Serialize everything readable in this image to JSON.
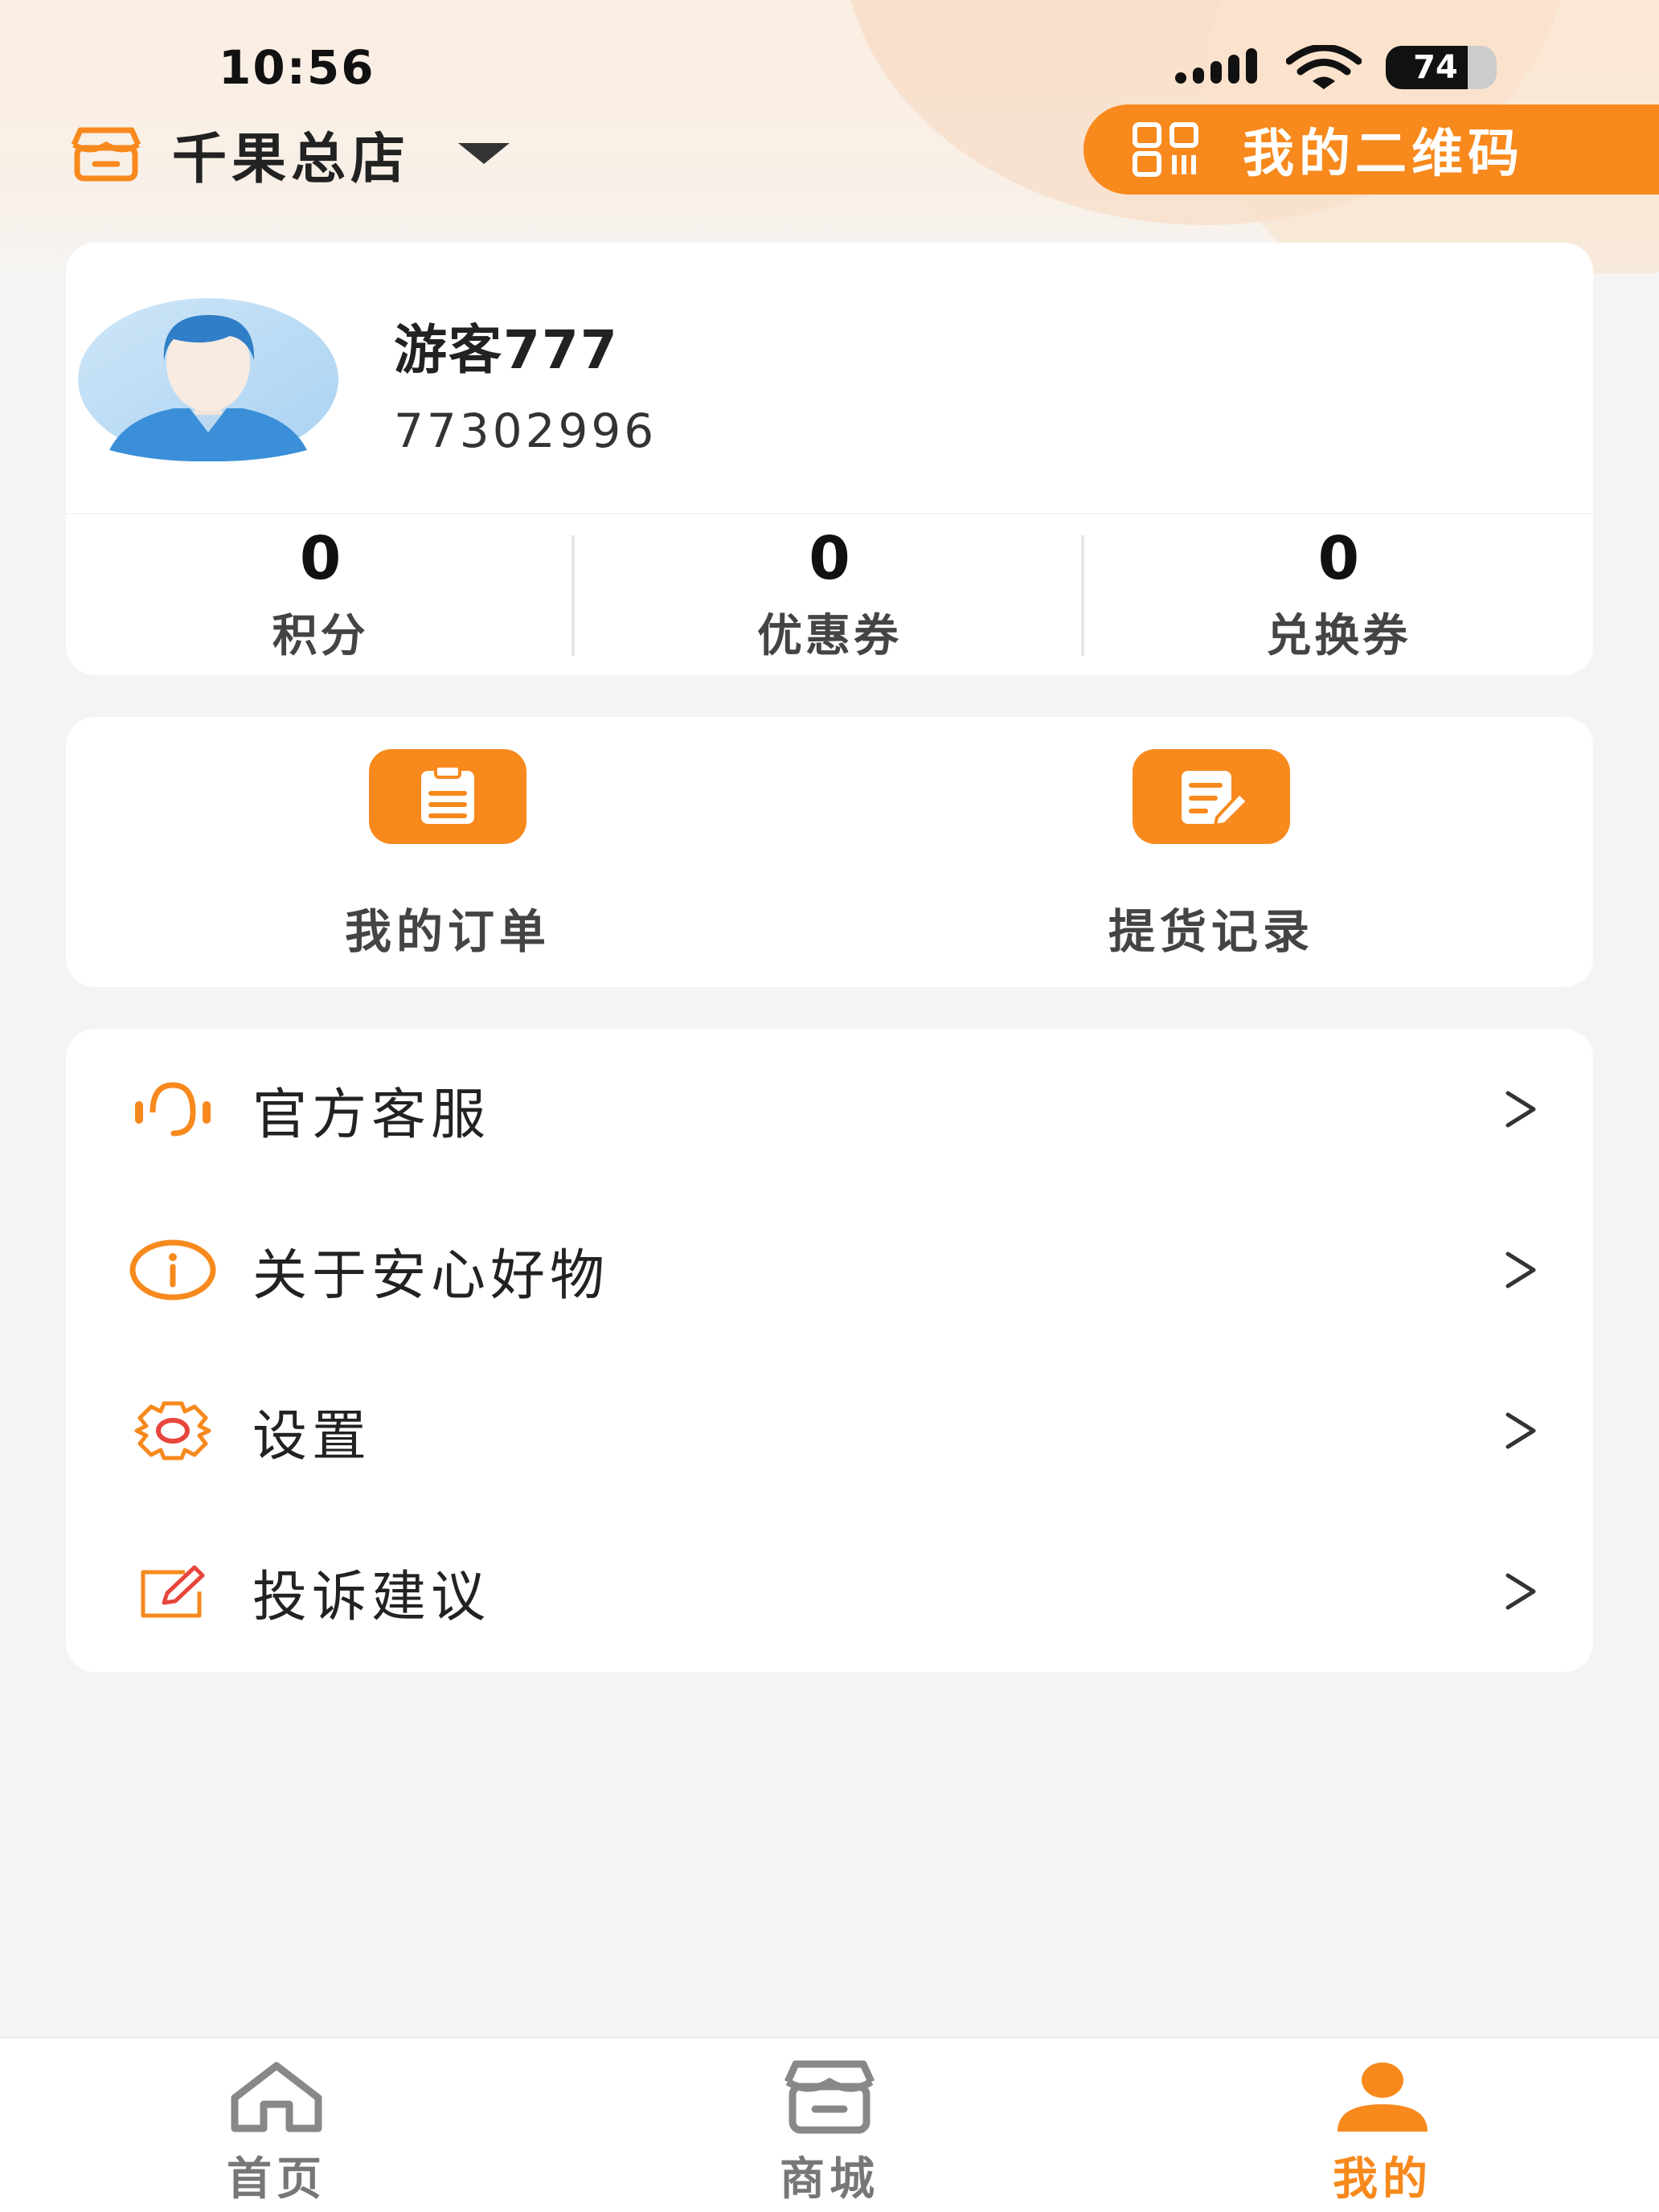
{
  "status_bar": {
    "time": "10:56",
    "battery": "74",
    "battery_level": 0.74
  },
  "header": {
    "store_name": "千果总店",
    "qr_button_label": "我的二维码"
  },
  "profile": {
    "name": "游客777",
    "id": "77302996"
  },
  "stats": [
    {
      "value": "0",
      "label": "积分"
    },
    {
      "value": "0",
      "label": "优惠券"
    },
    {
      "value": "0",
      "label": "兑换券"
    }
  ],
  "actions": [
    {
      "label": "我的订单",
      "icon": "clipboard-icon"
    },
    {
      "label": "提货记录",
      "icon": "edit-document-icon"
    }
  ],
  "menu": [
    {
      "label": "官方客服",
      "icon": "headset-icon"
    },
    {
      "label": "关于安心好物",
      "icon": "info-icon"
    },
    {
      "label": "设置",
      "icon": "gear-icon"
    },
    {
      "label": "投诉建议",
      "icon": "edit-icon"
    }
  ],
  "bottom_nav": [
    {
      "label": "首页",
      "icon": "home-icon",
      "active": false
    },
    {
      "label": "商城",
      "icon": "shop-icon",
      "active": false
    },
    {
      "label": "我的",
      "icon": "person-icon",
      "active": true
    }
  ],
  "colors": {
    "accent": "#f7891d",
    "background": "#f6f4f2",
    "card": "#ffffff",
    "menu_icon_red": "#e8453c"
  }
}
